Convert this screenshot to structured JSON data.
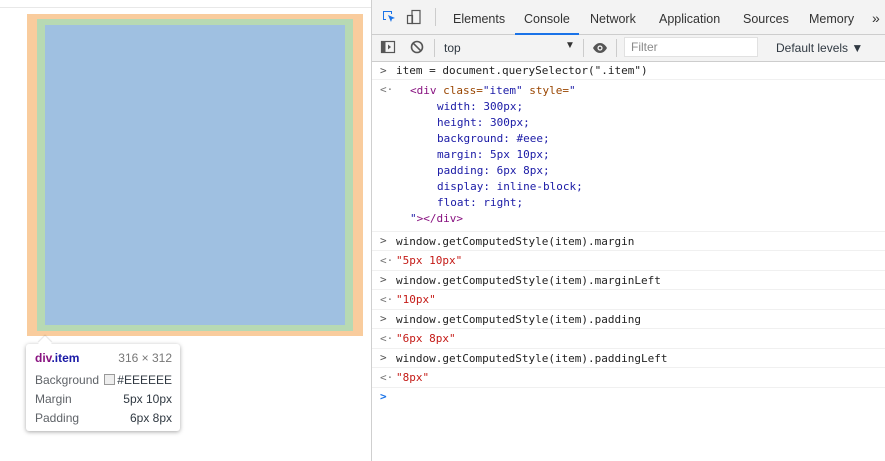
{
  "tooltip": {
    "tag": "div",
    "class": ".item",
    "size": "316 × 312",
    "background_label": "Background",
    "background_value": "#EEEEEE",
    "margin_label": "Margin",
    "margin_value": "5px 10px",
    "padding_label": "Padding",
    "padding_value": "6px 8px"
  },
  "tabs": [
    "Elements",
    "Console",
    "Network",
    "Application",
    "Sources",
    "Memory"
  ],
  "more_tabs": "»",
  "toolbar": {
    "context": "top",
    "context_arrow": "▼",
    "filter_placeholder": "Filter",
    "levels": "Default levels ▼"
  },
  "console": {
    "cmd1": "item = document.querySelector(\".item\")",
    "result1": {
      "open_tag": "<div",
      "class_attr": "class=",
      "class_val": "\"item\"",
      "style_attr": "style=",
      "style_open": "\"",
      "css_lines": [
        "width: 300px;",
        "height: 300px;",
        "background: #eee;",
        "margin: 5px 10px;",
        "padding: 6px 8px;",
        "display: inline-block;",
        "float: right;"
      ],
      "close_quote": "\"",
      "close_tag": "></div>"
    },
    "entries": [
      {
        "cmd": "window.getComputedStyle(item).margin",
        "result": "\"5px 10px\""
      },
      {
        "cmd": "window.getComputedStyle(item).marginLeft",
        "result": "\"10px\""
      },
      {
        "cmd": "window.getComputedStyle(item).padding",
        "result": "\"6px 8px\""
      },
      {
        "cmd": "window.getComputedStyle(item).paddingLeft",
        "result": "\"8px\""
      }
    ],
    "input_prompt": ">",
    "output_prompt": "<·",
    "cursor_prompt": ">"
  },
  "colors": {
    "margin": "#f9cc9d",
    "border": "#c3d08b",
    "padding": "#b7d9b3",
    "content": "#9fc0e1",
    "accent": "#1a73e8"
  }
}
